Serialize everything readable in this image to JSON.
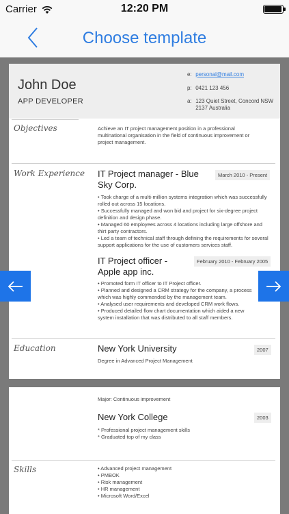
{
  "status": {
    "carrier": "Carrier",
    "time": "12:20 PM",
    "battery_level": 0.95
  },
  "nav": {
    "title": "Choose template"
  },
  "resume": {
    "name": "John Doe",
    "job_title": "APP DEVELOPER",
    "contact": {
      "email_label": "e:",
      "email": "personal@mail.com",
      "phone_label": "p:",
      "phone": "0421 123 456",
      "address_label": "a:",
      "address_line1": "123 Quiet Street, Concord NSW",
      "address_line2": "2137 Australia"
    },
    "objectives": {
      "label": "Objectives",
      "text": "Achieve an IT project management position in a professional multinational organisation in the field of continuous improvement or project management."
    },
    "work": {
      "label": "Work Experience",
      "jobs": [
        {
          "title_line1": "IT Project manager - Blue",
          "title_line2": "Sky Corp.",
          "date": "March 2010 - Present",
          "bullets": [
            "• Took charge of a multi-million systems integration which was successfully rolled out across 15 locations.",
            "• Successfully managed and won bid and project for six-degree project definition and design phase.",
            "• Managed 60 employees across 4 locations including large offshore and thirt party contractors.",
            "• Led a team of technical staff through defining the requirements for several support applications for the use of customers services staff."
          ]
        },
        {
          "title_line1": "IT Project officer -",
          "title_line2": "Apple app inc.",
          "date": "February 2010 - February 2005",
          "bullets": [
            "• Promoted form IT officer to IT Project officer.",
            "• Planned and designed a CRM strategy for the company, a process which was highly commended by the management team.",
            "• Analysed user requirements and developed CRM work flows.",
            "• Produced detailed flow chart documentation which aided a new system installation that was distributed to all staff members."
          ]
        }
      ]
    },
    "education": {
      "label": "Education",
      "schools": [
        {
          "name": "New York University",
          "date": "2007",
          "degree": "Degree in Advanced Project Management",
          "major": "Major: Continuous improvement"
        },
        {
          "name": "New York College",
          "date": "2003",
          "details": [
            "* Professional project management skills",
            "* Graduated top of my class"
          ]
        }
      ]
    },
    "skills": {
      "label": "Skills",
      "items": [
        "• Advanced project management",
        "• PMBOK",
        "• Risk management",
        "• HR management",
        "• Microsoft Word/Excel"
      ]
    }
  },
  "icons": {
    "back": "chevron-left-icon",
    "prev": "arrow-left-icon",
    "next": "arrow-right-icon",
    "wifi": "wifi-icon",
    "battery": "battery-icon"
  },
  "colors": {
    "accent": "#2f7de1",
    "arrow_button": "#1e74e8",
    "background": "#7a7a7a"
  }
}
